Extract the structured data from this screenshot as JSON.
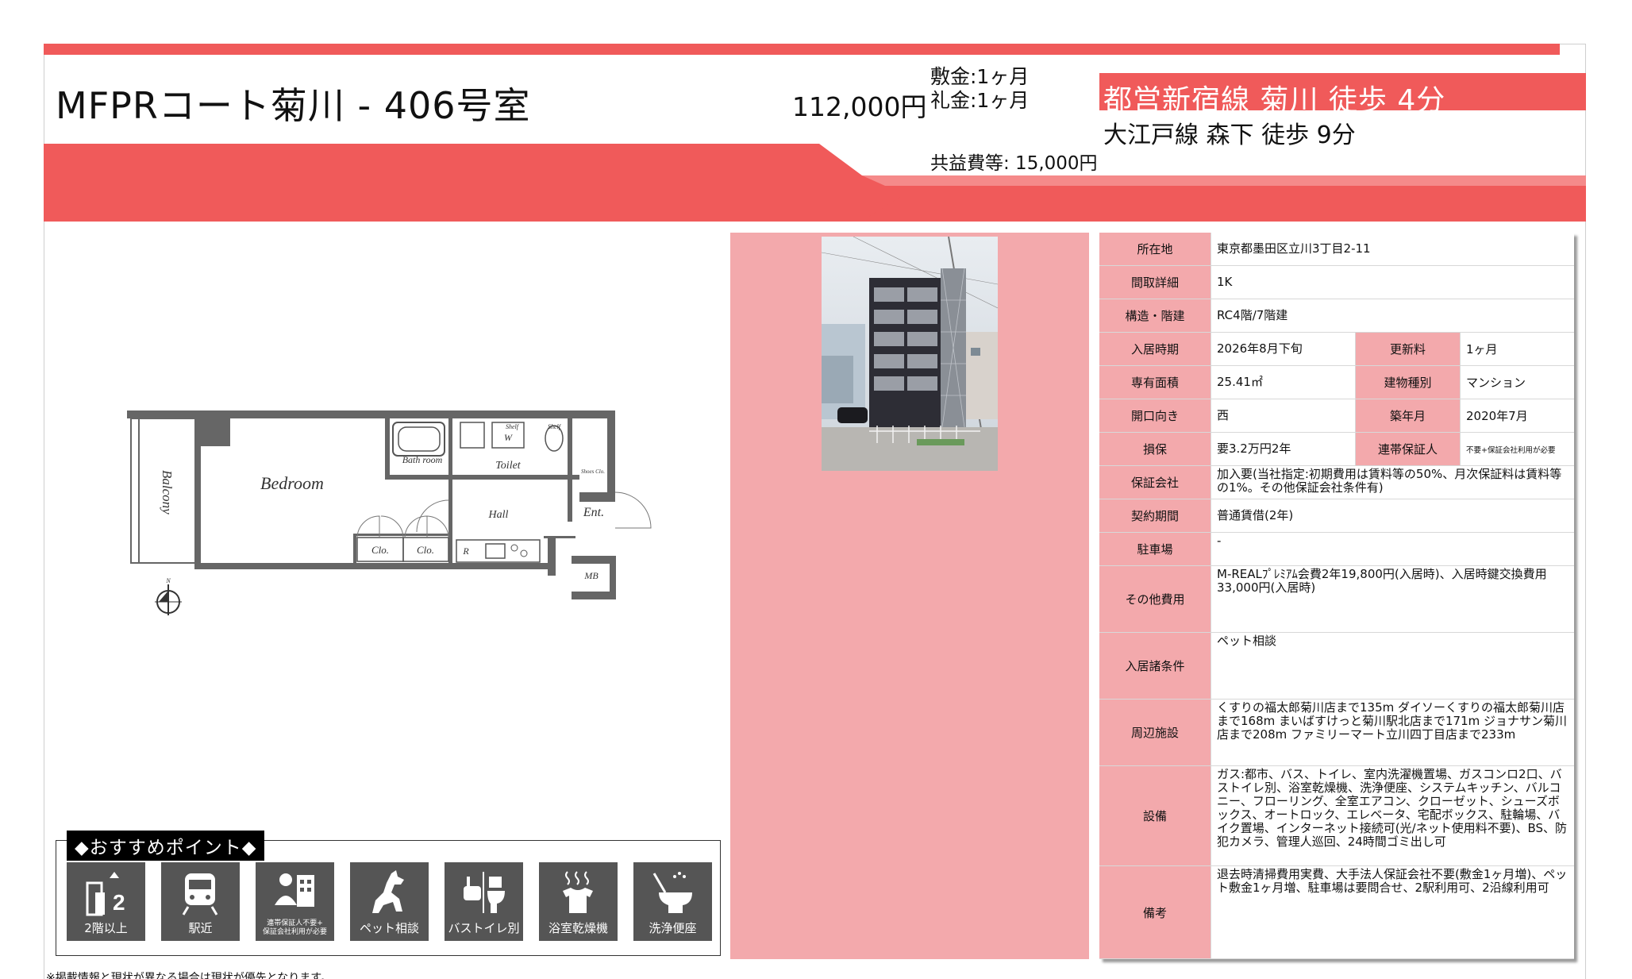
{
  "header": {
    "title": "MFPRコート菊川 - 406号室",
    "rent": "112,000円",
    "deposit": "敷金:1ヶ月",
    "key_money": "礼金:1ヶ月",
    "common_fee": "共益費等: 15,000円",
    "station_main": "都営新宿線 菊川 徒歩 4分",
    "station_sub": "大江戸線 森下 徒歩 9分"
  },
  "floorplan": {
    "rooms": {
      "bedroom": "Bedroom",
      "balcony": "Balcony",
      "bath": "Bath room",
      "toilet": "Toilet",
      "hall": "Hall",
      "entrance": "Ent.",
      "closet1": "Clo.",
      "closet2": "Clo.",
      "mb": "MB",
      "shelf1": "Shelf",
      "shelf2": "Shelf",
      "washer": "W",
      "shoes": "Shoes Clo.",
      "fridge": "R",
      "north": "N"
    }
  },
  "points": {
    "title": "◆おすすめポイント◆",
    "items": [
      {
        "label": "2階以上",
        "icon": "building-floor-icon"
      },
      {
        "label": "駅近",
        "icon": "train-icon"
      },
      {
        "label_line1": "連帯保証人不要+",
        "label_line2": "保証会社利用が必要",
        "icon": "guarantor-icon"
      },
      {
        "label": "ペット相談",
        "icon": "dog-icon"
      },
      {
        "label": "バストイレ別",
        "icon": "bath-toilet-icon"
      },
      {
        "label": "浴室乾燥機",
        "icon": "bath-dryer-icon"
      },
      {
        "label": "洗浄便座",
        "icon": "washlet-icon"
      }
    ]
  },
  "disclaimer": "※掲載情報と現状が異なる場合は現状が優先となります。",
  "info": {
    "address": {
      "label": "所在地",
      "value": "東京都墨田区立川3丁目2-11"
    },
    "layout": {
      "label": "間取詳細",
      "value": "1K"
    },
    "structure": {
      "label": "構造・階建",
      "value": "RC4階/7階建"
    },
    "move_in": {
      "label": "入居時期",
      "value": "2026年8月下旬"
    },
    "renewal": {
      "label": "更新料",
      "value": "1ヶ月"
    },
    "area": {
      "label": "専有面積",
      "value": "25.41㎡"
    },
    "building_type": {
      "label": "建物種別",
      "value": "マンション"
    },
    "direction": {
      "label": "開口向き",
      "value": "西"
    },
    "built": {
      "label": "築年月",
      "value": "2020年7月"
    },
    "damage_deposit": {
      "label": "損保",
      "value": "要3.2万円2年"
    },
    "joint_guarantor": {
      "label": "連帯保証人",
      "value": "不要+保証会社利用が必要"
    },
    "guarantee_company": {
      "label": "保証会社",
      "value": "加入要(当社指定:初期費用は賃料等の50%、月次保証料は賃料等の1%。その他保証会社条件有)"
    },
    "contract": {
      "label": "契約期間",
      "value": "普通賃借(2年)"
    },
    "parking": {
      "label": "駐車場",
      "value": "-"
    },
    "other_costs": {
      "label": "その他費用",
      "value": "M-REALﾌﾟﾚﾐｱﾑ会費2年19,800円(入居時)、入居時鍵交換費用33,000円(入居時)"
    },
    "conditions": {
      "label": "入居諸条件",
      "value": "ペット相談"
    },
    "nearby": {
      "label": "周辺施設",
      "value": "くすりの福太郎菊川店まで135m ダイソーくすりの福太郎菊川店まで168m まいばすけっと菊川駅北店まで171m ジョナサン菊川店まで208m ファミリーマート立川四丁目店まで233m"
    },
    "equipment": {
      "label": "設備",
      "value": "ガス:都市、バス、トイレ、室内洗濯機置場、ガスコンロ2口、バストイレ別、浴室乾燥機、洗浄便座、システムキッチン、バルコニー、フローリング、全室エアコン、クローゼット、シューズボックス、オートロック、エレベータ、宅配ボックス、駐輪場、バイク置場、インターネット接続可(光/ネット使用料不要)、BS、防犯カメラ、管理人巡回、24時間ゴミ出し可"
    },
    "notes": {
      "label": "備考",
      "value": "退去時清掃費用実費、大手法人保証会社不要(敷金1ヶ月増)、ペット敷金1ヶ月増、駐車場は要問合せ、2駅利用可、2沿線利用可"
    }
  },
  "colors": {
    "accent": "#f05a5a",
    "label_bg": "#f3a9ac",
    "icon_bg": "#555555"
  }
}
